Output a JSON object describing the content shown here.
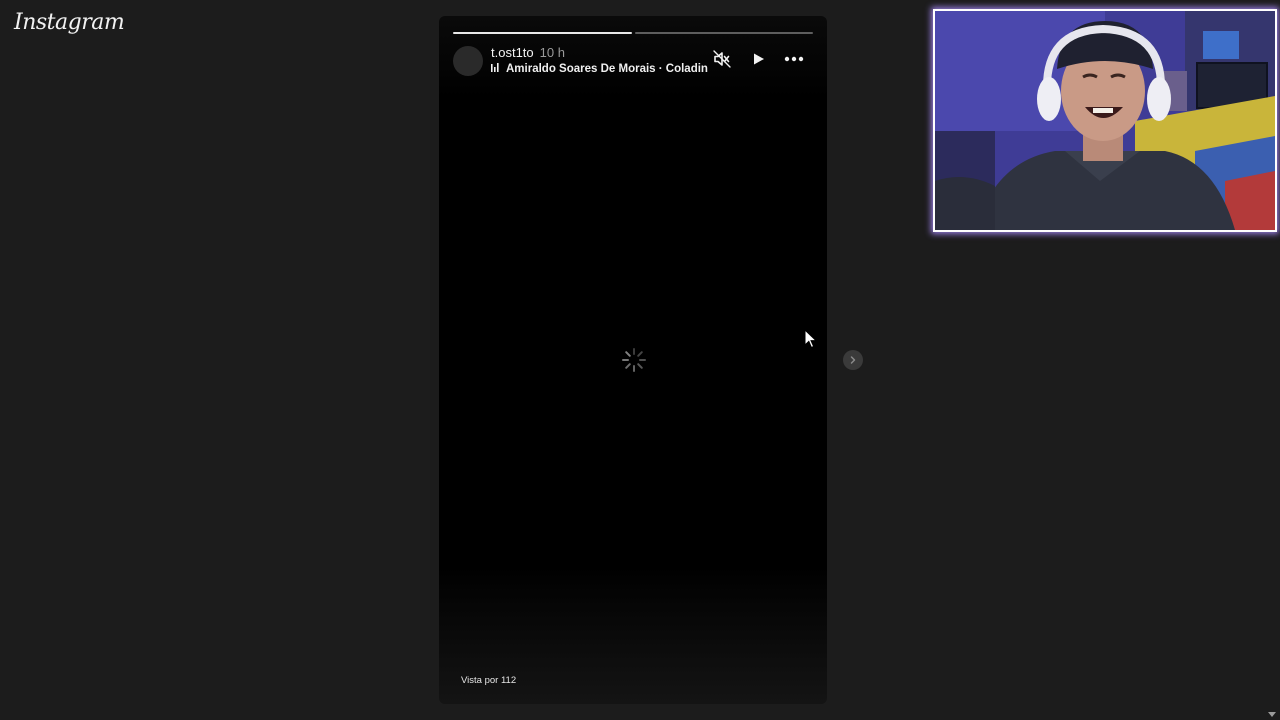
{
  "app": {
    "logo": "Instagram"
  },
  "story": {
    "progress": [
      1.0,
      0.0
    ],
    "username": "t.ost1to",
    "time_ago": "10 h",
    "music": "Amiraldo Soares De Morais · Coladinha",
    "views": "Vista por 112",
    "loading": true
  },
  "icons": {
    "mute": "speaker-muted-icon",
    "play": "play-icon",
    "more": "more-horizontal-icon",
    "music": "music-bars-icon",
    "next": "chevron-right-icon",
    "loading": "loading-spinner-icon"
  },
  "colors": {
    "background": "#1c1c1c",
    "story_bg": "#000000",
    "webcam_border": "#ffffff",
    "webcam_glow": "#aa8cff"
  }
}
